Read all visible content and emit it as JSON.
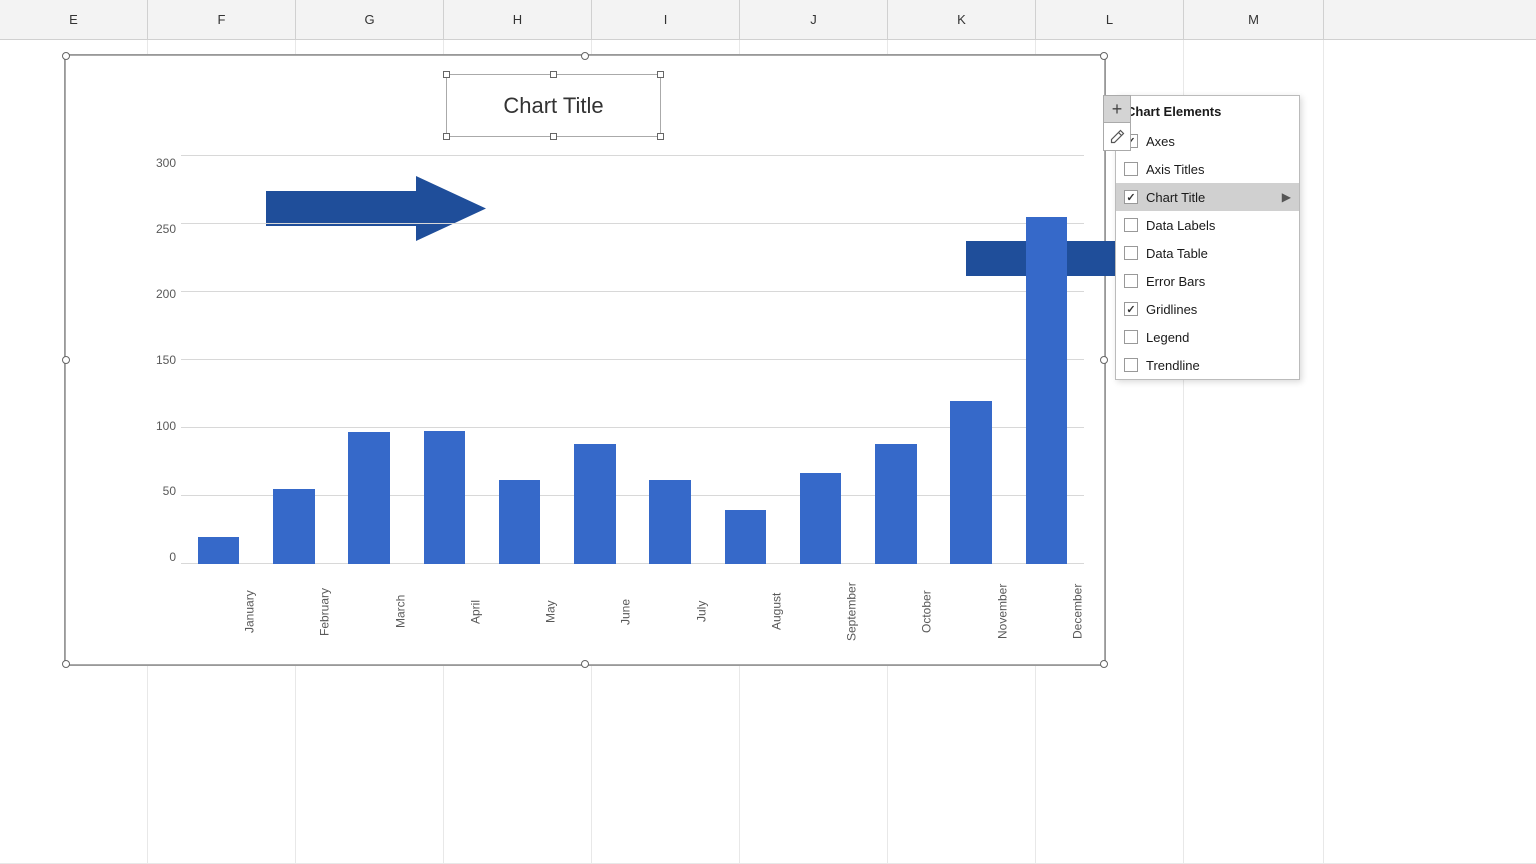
{
  "columns": [
    "E",
    "F",
    "G",
    "H",
    "I",
    "J",
    "K",
    "L",
    "M"
  ],
  "chart": {
    "title": "Chart Title",
    "yLabels": [
      "0",
      "50",
      "100",
      "150",
      "200",
      "250",
      "300"
    ],
    "months": [
      "January",
      "February",
      "March",
      "April",
      "May",
      "June",
      "July",
      "August",
      "September",
      "October",
      "November",
      "December"
    ],
    "values": [
      20,
      55,
      97,
      98,
      62,
      88,
      62,
      40,
      67,
      88,
      120,
      255
    ],
    "maxValue": 300
  },
  "panel": {
    "header": "Chart Elements",
    "items": [
      {
        "label": "Axes",
        "checked": true,
        "hasArrow": false
      },
      {
        "label": "Axis Titles",
        "checked": false,
        "hasArrow": false
      },
      {
        "label": "Chart Title",
        "checked": true,
        "hasArrow": true,
        "highlighted": true
      },
      {
        "label": "Data Labels",
        "checked": false,
        "hasArrow": false
      },
      {
        "label": "Data Table",
        "checked": false,
        "hasArrow": false
      },
      {
        "label": "Error Bars",
        "checked": false,
        "hasArrow": false
      },
      {
        "label": "Gridlines",
        "checked": true,
        "hasArrow": false
      },
      {
        "label": "Legend",
        "checked": false,
        "hasArrow": false
      },
      {
        "label": "Trendline",
        "checked": false,
        "hasArrow": false
      }
    ]
  },
  "plusBtn": "+",
  "pencilIcon": "✏"
}
